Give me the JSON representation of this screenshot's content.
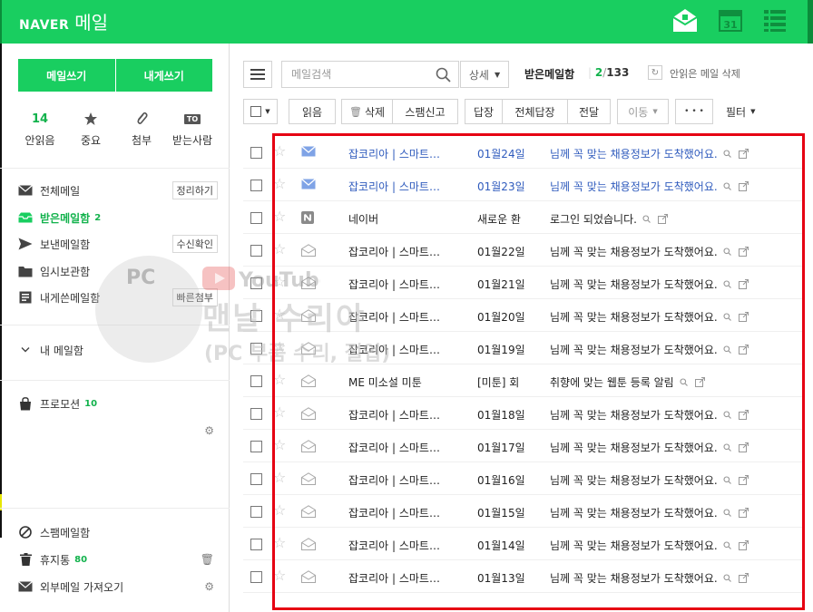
{
  "header": {
    "logo_brand": "NAVER",
    "logo_service": "메일",
    "calendar_day": "31",
    "accent_color": "#19ce60"
  },
  "sidebar": {
    "write_button": "메일쓰기",
    "self_write_button": "내게쓰기",
    "quick_filters": [
      {
        "count": "14",
        "label": "안읽음"
      },
      {
        "icon": "star-icon",
        "label": "중요"
      },
      {
        "icon": "paperclip-icon",
        "label": "첨부"
      },
      {
        "icon_text": "TO",
        "label": "받는사람"
      }
    ],
    "folders": [
      {
        "name": "전체메일",
        "button": "정리하기"
      },
      {
        "name": "받은메일함",
        "count": "2"
      },
      {
        "name": "보낸메일함",
        "button": "수신확인"
      },
      {
        "name": "임시보관함"
      },
      {
        "name": "내게쓴메일함",
        "button": "빠른첨부"
      }
    ],
    "my_mailbox": "내 메일함",
    "promotion": {
      "name": "프로모션",
      "count": "10"
    },
    "bottom_folders": [
      {
        "name": "스팸메일함"
      },
      {
        "name": "휴지통",
        "count": "80"
      },
      {
        "name": "외부메일 가져오기"
      }
    ]
  },
  "toolbar": {
    "search_placeholder": "메일검색",
    "detail_label": "상세",
    "folder_title": "받은메일함",
    "unread_count": "2",
    "count_separator": "/",
    "total_count": "133",
    "delete_unread": "안읽은 메일 삭제",
    "actions": {
      "read": "읽음",
      "delete": "삭제",
      "spam": "스팸신고",
      "reply": "답장",
      "reply_all": "전체답장",
      "forward": "전달",
      "move": "이동",
      "more": "• • •",
      "filter": "필터"
    }
  },
  "mails": [
    {
      "sender": "잡코리아 | 스마트…",
      "date": "01월24일",
      "subject": "님께 꼭 맞는 채용정보가 도착했어요.",
      "unread": true,
      "type": "envelope-closed"
    },
    {
      "sender": "잡코리아 | 스마트…",
      "date": "01월23일",
      "subject": "님께 꼭 맞는 채용정보가 도착했어요.",
      "unread": true,
      "type": "envelope-closed"
    },
    {
      "sender": "네이버",
      "date": "새로운 환",
      "subject": "로그인 되었습니다.",
      "unread": false,
      "type": "naver-badge"
    },
    {
      "sender": "잡코리아 | 스마트…",
      "date": "01월22일",
      "subject": "님께 꼭 맞는 채용정보가 도착했어요.",
      "unread": false,
      "type": "envelope-open"
    },
    {
      "sender": "잡코리아 | 스마트…",
      "date": "01월21일",
      "subject": "님께 꼭 맞는 채용정보가 도착했어요.",
      "unread": false,
      "type": "envelope-open"
    },
    {
      "sender": "잡코리아 | 스마트…",
      "date": "01월20일",
      "subject": "님께 꼭 맞는 채용정보가 도착했어요.",
      "unread": false,
      "type": "envelope-open"
    },
    {
      "sender": "잡코리아 | 스마트…",
      "date": "01월19일",
      "subject": "님께 꼭 맞는 채용정보가 도착했어요.",
      "unread": false,
      "type": "envelope-open"
    },
    {
      "sender": "ME 미소설 미툰",
      "date": "[미툰] 회",
      "subject": "취향에 맞는 웹툰 등록 알림",
      "unread": false,
      "type": "envelope-open"
    },
    {
      "sender": "잡코리아 | 스마트…",
      "date": "01월18일",
      "subject": "님께 꼭 맞는 채용정보가 도착했어요.",
      "unread": false,
      "type": "envelope-open"
    },
    {
      "sender": "잡코리아 | 스마트…",
      "date": "01월17일",
      "subject": "님께 꼭 맞는 채용정보가 도착했어요.",
      "unread": false,
      "type": "envelope-open"
    },
    {
      "sender": "잡코리아 | 스마트…",
      "date": "01월16일",
      "subject": "님께 꼭 맞는 채용정보가 도착했어요.",
      "unread": false,
      "type": "envelope-open"
    },
    {
      "sender": "잡코리아 | 스마트…",
      "date": "01월15일",
      "subject": "님께 꼭 맞는 채용정보가 도착했어요.",
      "unread": false,
      "type": "envelope-open"
    },
    {
      "sender": "잡코리아 | 스마트…",
      "date": "01월14일",
      "subject": "님께 꼭 맞는 채용정보가 도착했어요.",
      "unread": false,
      "type": "envelope-open"
    },
    {
      "sender": "잡코리아 | 스마트…",
      "date": "01월13일",
      "subject": "님께 꼭 맞는 채용정보가 도착했어요.",
      "unread": false,
      "type": "envelope-open"
    }
  ],
  "watermark": {
    "badge": "PC",
    "channel": "YouTube",
    "title": "맨날 수리야",
    "subtitle": "(PC 부품 수리, 절업)"
  },
  "highlight_color": "#e60012"
}
